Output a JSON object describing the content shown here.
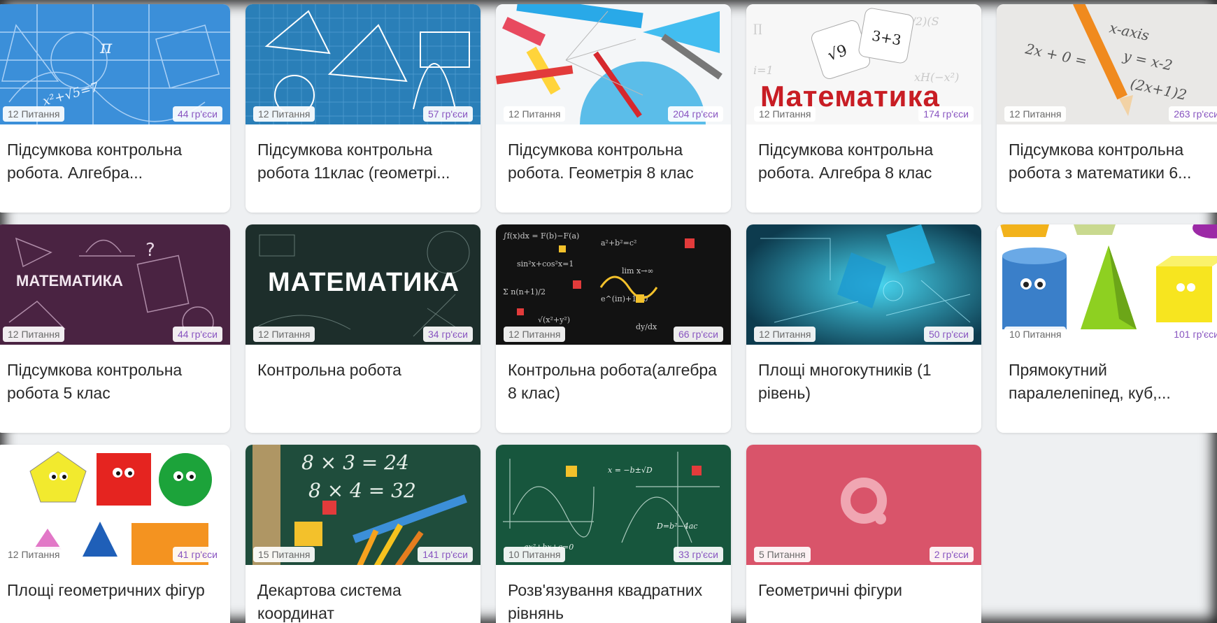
{
  "cards": [
    {
      "questions": "12 Питання",
      "plays": "44 гр'єси",
      "title": "Підсумкова контрольна робота. Алгебра...",
      "thumb": "math-formulas-blue"
    },
    {
      "questions": "12 Питання",
      "plays": "57 гр'єси",
      "title": "Підсумкова контрольна робота 11клас (геометрі...",
      "thumb": "geometry-blueprint"
    },
    {
      "questions": "12 Питання",
      "plays": "204 гр'єси",
      "title": "Підсумкова контрольна робота. Геометрія 8 клас",
      "thumb": "drawing-tools"
    },
    {
      "questions": "12 Питання",
      "plays": "174 гр'єси",
      "title": "Підсумкова контрольна робота. Алгебра 8 клас",
      "thumb": "math-dice",
      "thumb_text": "Математика"
    },
    {
      "questions": "12 Питання",
      "plays": "263 гр'єси",
      "title": "Підсумкова контрольна робота з математики 6...",
      "thumb": "pencil-equations"
    },
    {
      "questions": "12 Питання",
      "plays": "44 гр'єси",
      "title": "Підсумкова контрольна робота 5 клас",
      "thumb": "purple-math",
      "thumb_text": "МАТЕМАТИКА"
    },
    {
      "questions": "12 Питання",
      "plays": "34 гр'єси",
      "title": "Контрольна робота",
      "thumb": "chalkboard-math",
      "thumb_text": "МАТЕМАТИКА"
    },
    {
      "questions": "12 Питання",
      "plays": "66 гр'єси",
      "title": "Контрольна робота(алгебра 8 клас)",
      "thumb": "dark-formulas"
    },
    {
      "questions": "12 Питання",
      "plays": "50 гр'єси",
      "title": "Площі многокутників (1 рівень)",
      "thumb": "cyan-tech"
    },
    {
      "questions": "10 Питання",
      "plays": "101 гр'єси",
      "title": "Прямокутний паралелепіпед, куб,...",
      "thumb": "3d-shapes"
    },
    {
      "questions": "12 Питання",
      "plays": "41 гр'єси",
      "title": "Площі геометричних фігур",
      "thumb": "cartoon-shapes"
    },
    {
      "questions": "15 Питання",
      "plays": "141 гр'єси",
      "title": "Декартова система координат",
      "thumb": "school-supplies"
    },
    {
      "questions": "10 Питання",
      "plays": "33 гр'єси",
      "title": "Розв'язування квадратних рівнянь",
      "thumb": "green-chalkboard"
    },
    {
      "questions": "5 Питання",
      "plays": "2 гр'єси",
      "title": "Геометричні фігури",
      "thumb": "quizizz-logo"
    }
  ]
}
